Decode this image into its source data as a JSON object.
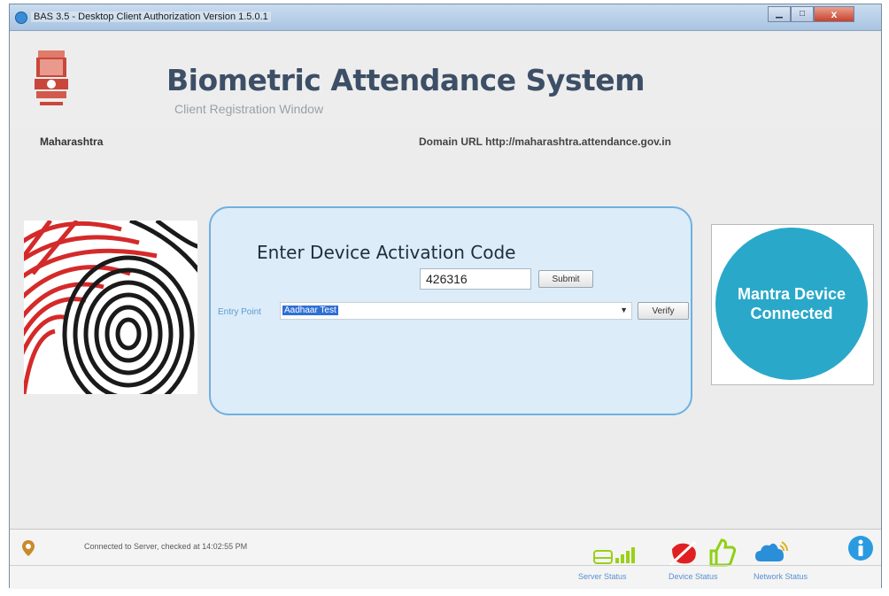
{
  "window": {
    "title": "BAS 3.5 - Desktop Client Authorization Version 1.5.0.1",
    "close_label": "x"
  },
  "header": {
    "title": "Biometric Attendance System",
    "subtitle": "Client Registration Window",
    "state": "Maharashtra",
    "domain": "Domain URL http://maharashtra.attendance.gov.in"
  },
  "activation": {
    "heading": "Enter Device Activation Code",
    "code_value": "426316",
    "submit_label": "Submit",
    "entry_point_label": "Entry Point",
    "entry_point_value": "Aadhaar Test",
    "verify_label": "Verify"
  },
  "device": {
    "line1": "Mantra Device",
    "line2": "Connected",
    "color": "#2aa8c9"
  },
  "status": {
    "connection_text": "Connected to Server, checked at 14:02:55 PM",
    "server_caption": "Server Status",
    "device_caption": "Device Status",
    "network_caption": "Network Status"
  },
  "icons": {
    "app": "app-icon",
    "emblem": "emblem-icon",
    "fingerprint": "fingerprint-image",
    "location": "location-pin-icon",
    "server": "server-signal-icon",
    "device": "device-status-icon",
    "thumbs": "thumbs-up-icon",
    "network": "cloud-wifi-icon",
    "info": "info-icon"
  }
}
